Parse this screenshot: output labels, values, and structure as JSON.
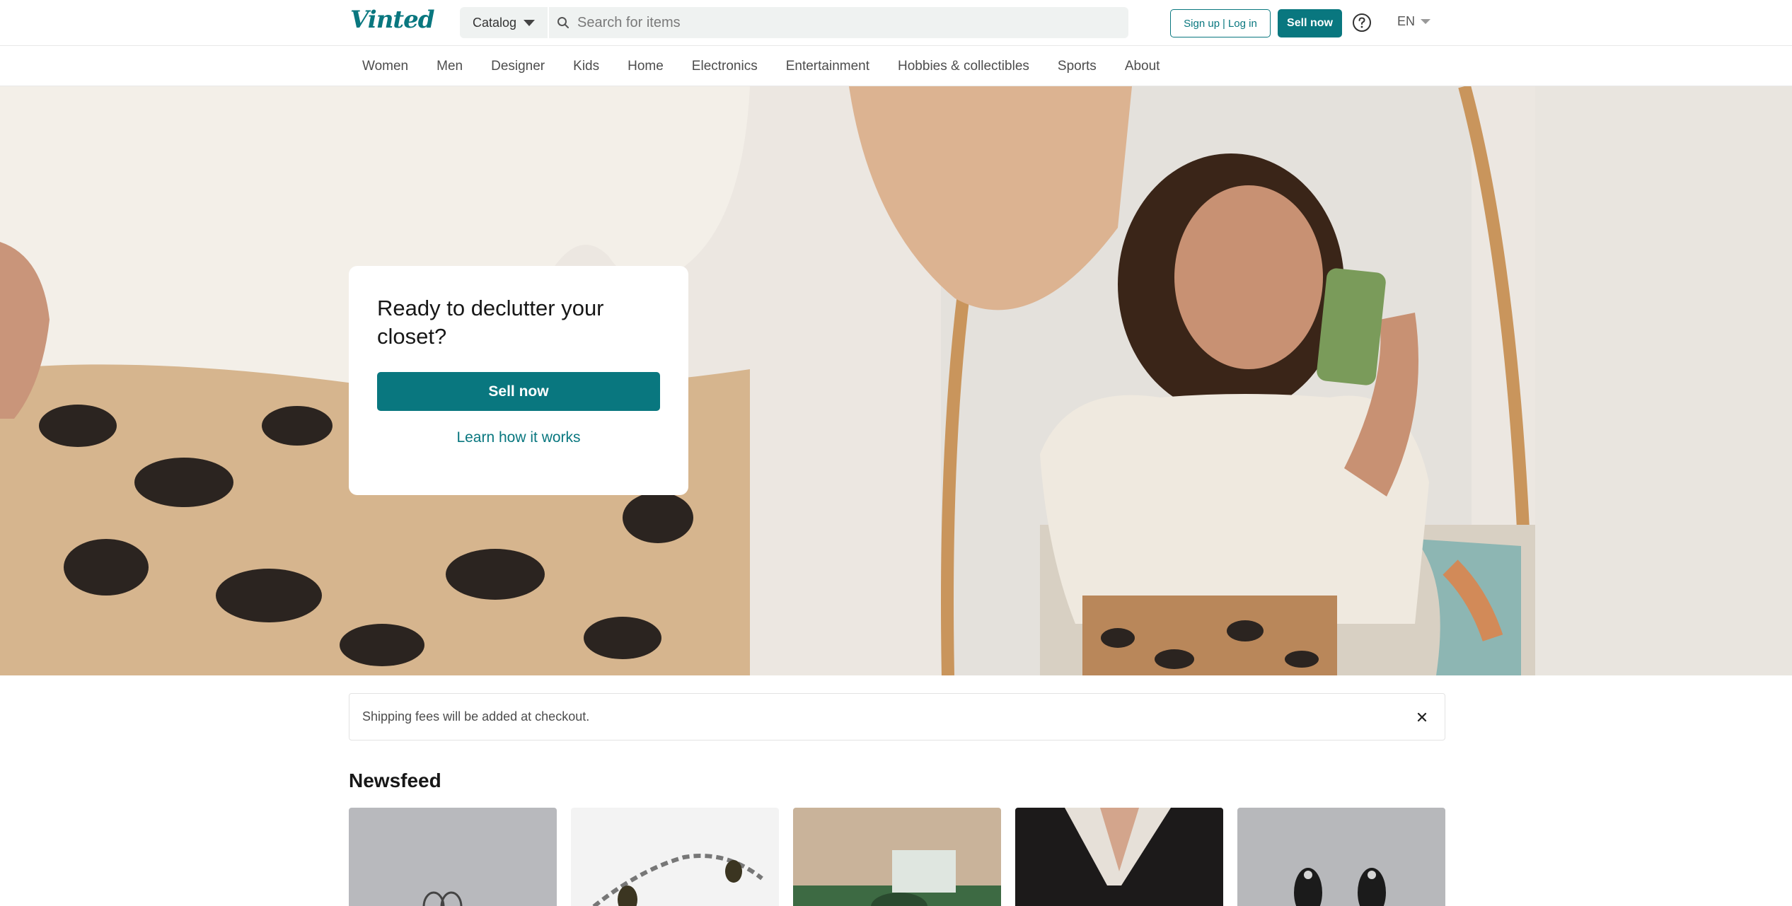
{
  "header": {
    "logo": "Vinted",
    "catalog_label": "Catalog",
    "search_placeholder": "Search for items",
    "signup_label": "Sign up",
    "separator": "|",
    "login_label": "Log in",
    "sell_label": "Sell now",
    "language": "EN"
  },
  "nav": {
    "items": [
      "Women",
      "Men",
      "Designer",
      "Kids",
      "Home",
      "Electronics",
      "Entertainment",
      "Hobbies & collectibles",
      "Sports",
      "About"
    ]
  },
  "hero": {
    "title": "Ready to declutter your closet?",
    "button_label": "Sell now",
    "link_label": "Learn how it works"
  },
  "notice": {
    "text": "Shipping fees will be added at checkout."
  },
  "newsfeed": {
    "title": "Newsfeed"
  },
  "colors": {
    "brand": "#09777f",
    "search_bg": "#eff2f1",
    "text": "#171717"
  }
}
